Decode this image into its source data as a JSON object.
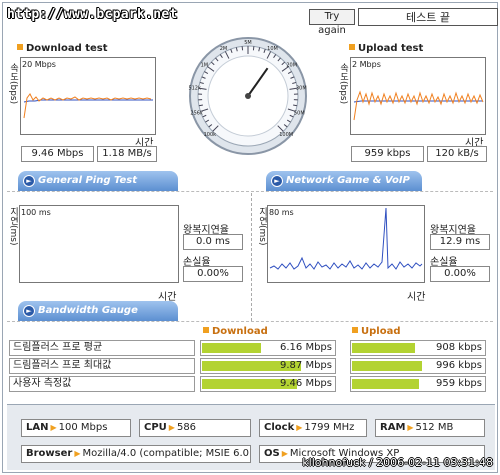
{
  "header": {
    "site_url": "http://www.bcpark.net",
    "try_again_label": "Try again",
    "status_text": "테스트 끝"
  },
  "download": {
    "title": "Download test",
    "ylabel": "속도(bps)",
    "scale": "20 Mbps",
    "xlabel": "시간",
    "value_mbps": "9.46 Mbps",
    "value_mbs": "1.18 MB/s"
  },
  "upload": {
    "title": "Upload test",
    "ylabel": "속도(bps)",
    "scale": "2 Mbps",
    "xlabel": "시간",
    "value_kbps": "959 kbps",
    "value_kbs": "120 kB/s"
  },
  "gauge": {
    "ticks": [
      "100k",
      "256k",
      "512k",
      "1M",
      "2M",
      "5M",
      "10M",
      "20M",
      "30M",
      "50M",
      "100M"
    ],
    "needle_fraction": 0.63
  },
  "tabs": {
    "ping": "General Ping Test",
    "game": "Network Game & VoIP Test",
    "bandwidth": "Bandwidth Gauge"
  },
  "ping": {
    "ylabel": "지연(ms)",
    "scale": "100 ms",
    "xlabel": "시간",
    "rtt_label": "왕복지연율",
    "rtt_value": "0.0 ms",
    "loss_label": "손실율",
    "loss_value": "0.00%"
  },
  "game": {
    "ylabel": "지연(ms)",
    "scale": "80 ms",
    "xlabel": "시간",
    "rtt_label": "왕복지연율",
    "rtt_value": "12.9 ms",
    "loss_label": "손실율",
    "loss_value": "0.00%"
  },
  "bandwidth": {
    "download_header": "Download",
    "upload_header": "Upload",
    "rows": [
      {
        "label": "드림플러스 프로 평균",
        "down": "6.16 Mbps",
        "down_fill": 0.45,
        "up": "908 kbps",
        "up_fill": 0.48
      },
      {
        "label": "드림플러스 프로 최대값",
        "down": "9.87 Mbps",
        "down_fill": 0.75,
        "up": "996 kbps",
        "up_fill": 0.53
      },
      {
        "label": "사용자 측정값",
        "down": "9.46 Mbps",
        "down_fill": 0.72,
        "up": "959 kbps",
        "up_fill": 0.51
      }
    ]
  },
  "system": {
    "lan_label": "LAN",
    "lan_value": "100 Mbps",
    "cpu_label": "CPU",
    "cpu_value": "586",
    "clock_label": "Clock",
    "clock_value": "1799 MHz",
    "ram_label": "RAM",
    "ram_value": "512 MB",
    "browser_label": "Browser",
    "browser_value": "Mozilla/4.0 (compatible; MSIE 6.0",
    "os_label": "OS",
    "os_value": "Microsoft Windows XP"
  },
  "watermark": "kllohnofuck / 2006-02-11 03:31:48",
  "colors": {
    "download_line": "#f08020",
    "baseline_line": "#3050c0",
    "ping_line": "#3050c0",
    "bar_fill": "#b3d332",
    "tab_blue": "#5c8fd1"
  }
}
